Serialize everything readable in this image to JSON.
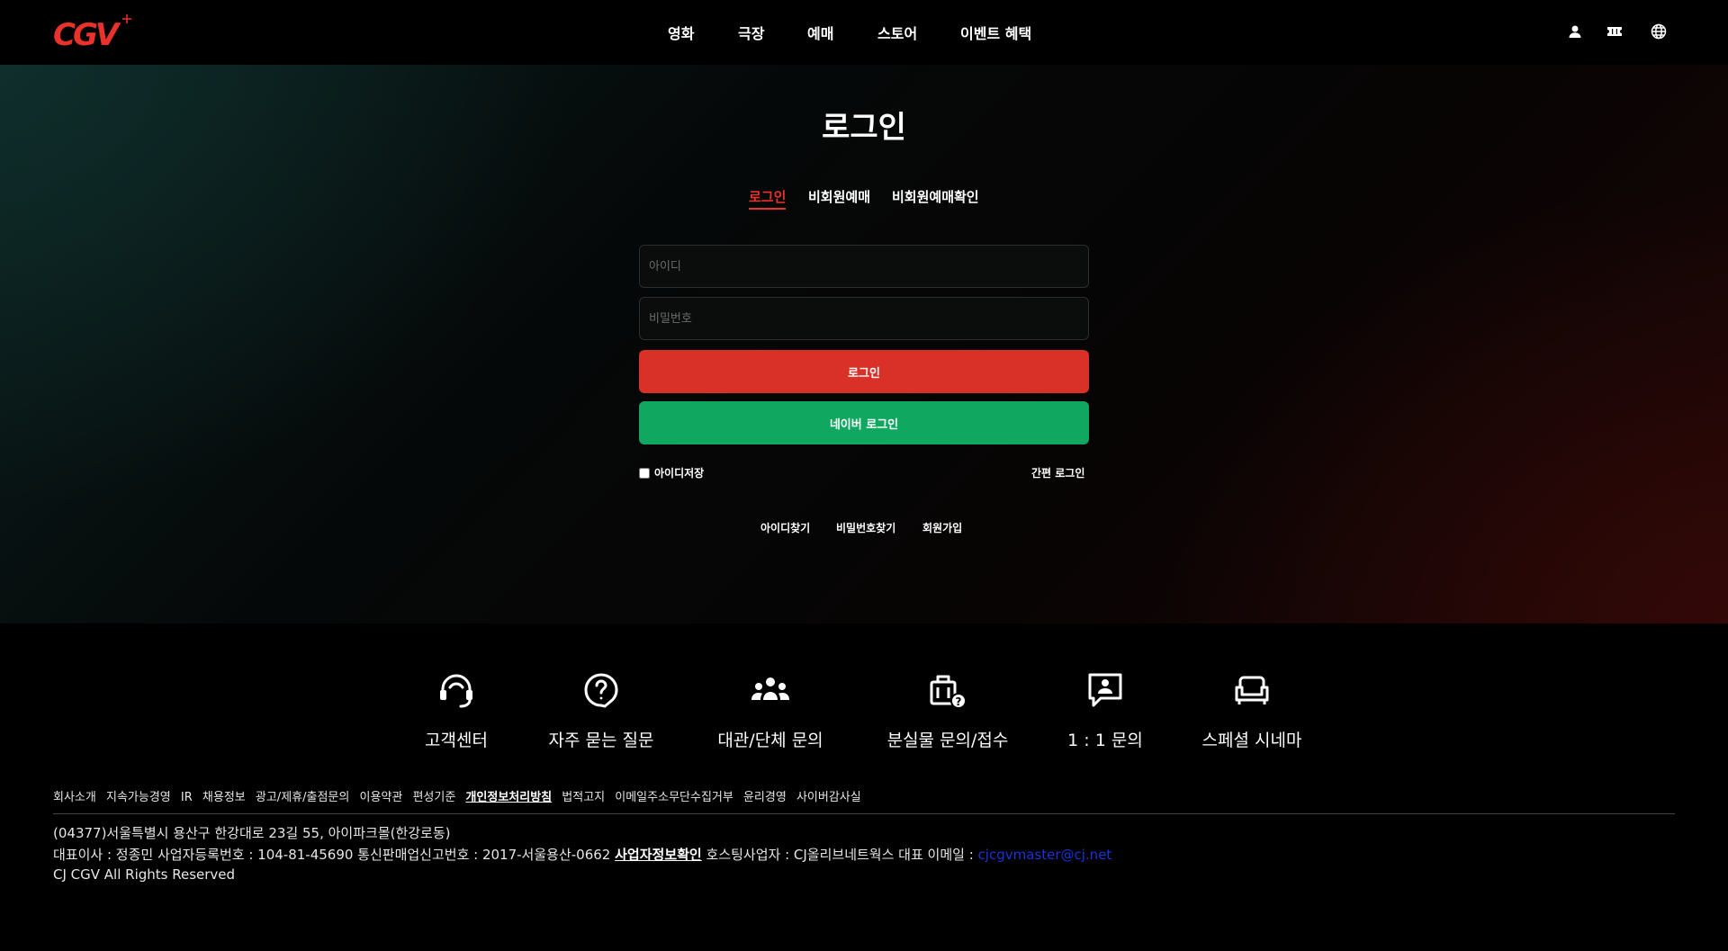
{
  "header": {
    "logo_text": "CGV",
    "nav": [
      "영화",
      "극장",
      "예매",
      "스토어",
      "이벤트 혜택"
    ],
    "icons": [
      "user-icon",
      "ticket-icon",
      "globe-icon"
    ]
  },
  "login": {
    "title": "로그인",
    "tabs": [
      "로그인",
      "비회원예매",
      "비회원예매확인"
    ],
    "id_placeholder": "아이디",
    "pw_placeholder": "비밀번호",
    "login_button": "로그인",
    "naver_button": "네이버 로그인",
    "remember_label": "아이디저장",
    "easy_login": "간편 로그인",
    "sublinks": [
      "아이디찾기",
      "비밀번호찾기",
      "회원가입"
    ]
  },
  "services": [
    {
      "label": "고객센터",
      "icon": "headset-icon"
    },
    {
      "label": "자주 묻는 질문",
      "icon": "question-icon"
    },
    {
      "label": "대관/단체 문의",
      "icon": "group-icon"
    },
    {
      "label": "분실물 문의/접수",
      "icon": "lost-item-icon"
    },
    {
      "label": "1 : 1 문의",
      "icon": "chat-user-icon"
    },
    {
      "label": "스페셜 시네마",
      "icon": "sofa-icon"
    }
  ],
  "footer": {
    "links": [
      "회사소개",
      "지속가능경영",
      "IR",
      "채용정보",
      "광고/제휴/출점문의",
      "이용약관",
      "편성기준",
      "개인정보처리방침",
      "법적고지",
      "이메일주소무단수집거부",
      "윤리경영",
      "사이버감사실"
    ],
    "address": "(04377)서울특별시 용산구 한강대로 23길 55, 아이파크몰(한강로동)",
    "ceo_line": "대표이사 : 정종민 사업자등록번호 : 104-81-45690 통신판매업신고번호 : 2017-서울용산-0662",
    "business_check": "사업자정보확인",
    "hosting_line": "호스팅사업자 : CJ올리브네트웍스 대표 이메일 :",
    "email": "cjcgvmaster@cj.net",
    "copyright": "CJ CGV All Rights Reserved"
  },
  "colors": {
    "brand_red": "#d93127",
    "naver_green": "#10a861",
    "active_tab": "#e8322a",
    "email_link": "#1a33d6"
  }
}
